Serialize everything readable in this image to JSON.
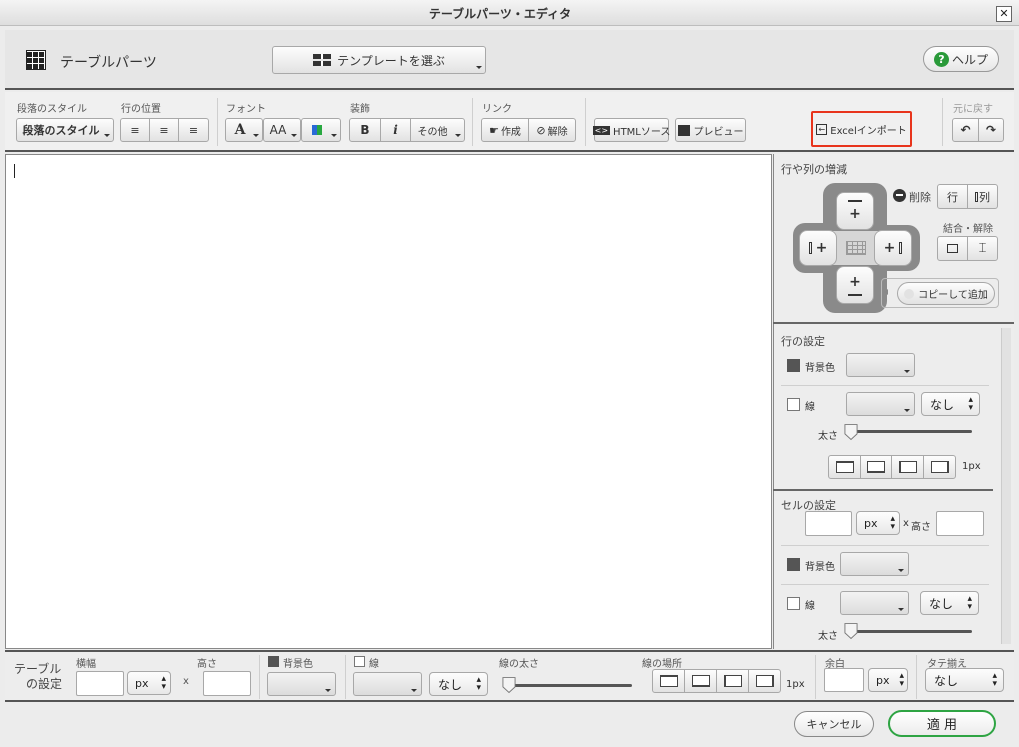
{
  "window": {
    "title": "テーブルパーツ・エディタ",
    "close_glyph": "✕"
  },
  "header": {
    "title": "テーブルパーツ",
    "template_button": "テンプレートを選ぶ",
    "help_button": "ヘルプ"
  },
  "toolbar": {
    "para_style_group": "段落のスタイル",
    "para_style_button": "段落のスタイル",
    "line_pos_group": "行の位置",
    "font_group": "フォント",
    "font_color_glyph": "A",
    "font_size_glyph": "AA",
    "deco_group": "装飾",
    "bold": "B",
    "italic": "i",
    "other": "その他",
    "link_group": "リンク",
    "link_create": "作成",
    "link_remove": "解除",
    "html_source": "HTMLソース",
    "preview": "プレビュー",
    "excel_import": "Excelインポート",
    "undo_group": "元に戻す",
    "highlight_color": "#e8341c"
  },
  "right_panel": {
    "rowcol_title": "行や列の増減",
    "plus": "+",
    "delete_label": "削除",
    "delete_row": "行",
    "delete_col": "列",
    "merge_label": "結合・解除",
    "copy_add": "コピーして追加",
    "row_settings": {
      "title": "行の設定",
      "bg_label": "背景色",
      "line_label": "線",
      "line_value": "なし",
      "thickness_label": "太さ",
      "thickness_value": "1px"
    },
    "cell_settings": {
      "title": "セルの設定",
      "width_unit": "px",
      "x": "x",
      "height_label": "高さ",
      "bg_label": "背景色",
      "line_label": "線",
      "line_value": "なし",
      "thickness_label": "太さ"
    }
  },
  "bottom": {
    "label_line1": "テーブル",
    "label_line2": "の設定",
    "width_label": "横幅",
    "width_unit": "px",
    "x": "x",
    "height_label": "高さ",
    "bg_label": "背景色",
    "line_label": "線",
    "line_value": "なし",
    "thickness_label": "線の太さ",
    "location_label": "線の場所",
    "thickness_value": "1px",
    "margin_label": "余白",
    "margin_unit": "px",
    "valign_label": "タテ揃え",
    "valign_value": "なし"
  },
  "footer": {
    "cancel": "キャンセル",
    "apply": "適 用",
    "apply_color": "#2ea443"
  }
}
